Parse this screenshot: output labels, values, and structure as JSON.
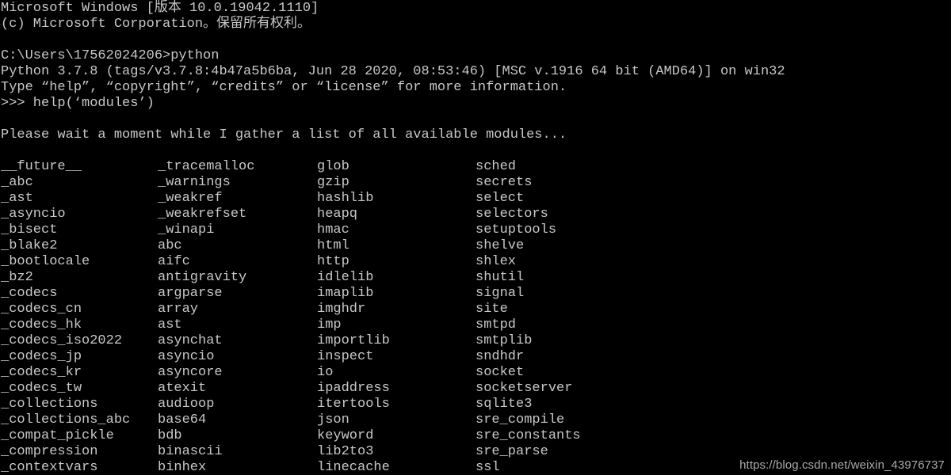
{
  "terminal": {
    "app_name": "Command Prompt",
    "background_color": "#000000",
    "text_color": "#c8c8c8",
    "header_lines": [
      "Microsoft Windows [版本 10.0.19042.1110]",
      "(c) Microsoft Corporation。保留所有权利。",
      "",
      "C:\\Users\\17562024206>python",
      "Python 3.7.8 (tags/v3.7.8:4b47a5b6ba, Jun 28 2020, 08:53:46) [MSC v.1916 64 bit (AMD64)] on win32",
      "Type “help”, “copyright”, “credits” or “license” for more information.",
      ">>> help(‘modules’)",
      "",
      "Please wait a moment while I gather a list of all available modules..."
    ]
  },
  "module_list": {
    "columns": 4,
    "rows": [
      [
        "__future__",
        "_tracemalloc",
        "glob",
        "sched"
      ],
      [
        "_abc",
        "_warnings",
        "gzip",
        "secrets"
      ],
      [
        "_ast",
        "_weakref",
        "hashlib",
        "select"
      ],
      [
        "_asyncio",
        "_weakrefset",
        "heapq",
        "selectors"
      ],
      [
        "_bisect",
        "_winapi",
        "hmac",
        "setuptools"
      ],
      [
        "_blake2",
        "abc",
        "html",
        "shelve"
      ],
      [
        "_bootlocale",
        "aifc",
        "http",
        "shlex"
      ],
      [
        "_bz2",
        "antigravity",
        "idlelib",
        "shutil"
      ],
      [
        "_codecs",
        "argparse",
        "imaplib",
        "signal"
      ],
      [
        "_codecs_cn",
        "array",
        "imghdr",
        "site"
      ],
      [
        "_codecs_hk",
        "ast",
        "imp",
        "smtpd"
      ],
      [
        "_codecs_iso2022",
        "asynchat",
        "importlib",
        "smtplib"
      ],
      [
        "_codecs_jp",
        "asyncio",
        "inspect",
        "sndhdr"
      ],
      [
        "_codecs_kr",
        "asyncore",
        "io",
        "socket"
      ],
      [
        "_codecs_tw",
        "atexit",
        "ipaddress",
        "socketserver"
      ],
      [
        "_collections",
        "audioop",
        "itertools",
        "sqlite3"
      ],
      [
        "_collections_abc",
        "base64",
        "json",
        "sre_compile"
      ],
      [
        "_compat_pickle",
        "bdb",
        "keyword",
        "sre_constants"
      ],
      [
        "_compression",
        "binascii",
        "lib2to3",
        "sre_parse"
      ],
      [
        "_contextvars",
        "binhex",
        "linecache",
        "ssl"
      ]
    ]
  },
  "watermark": {
    "text": "https://blog.csdn.net/weixin_43976737"
  }
}
